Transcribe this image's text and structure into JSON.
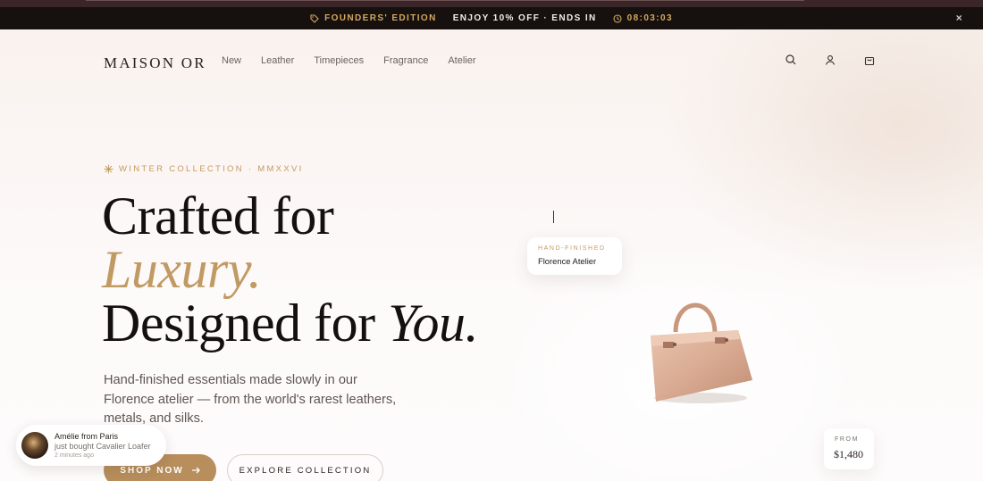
{
  "promo": {
    "edition": "FOUNDERS' EDITION",
    "offer": "ENJOY 10% OFF · ENDS IN",
    "timer": "08:03:03",
    "close": "×"
  },
  "nav": {
    "brand": "MAISON OR",
    "links": [
      "New",
      "Leather",
      "Timepieces",
      "Fragrance",
      "Atelier"
    ]
  },
  "hero": {
    "eyebrow": "WINTER COLLECTION · MMXXVI",
    "line1": "Crafted for",
    "line2": "Luxury.",
    "line3a": "Designed for ",
    "line3b": "You.",
    "sub": "Hand-finished essentials made slowly in our Florence atelier — from the world's rarest leathers, metals, and silks.",
    "shop_label": "SHOP NOW",
    "explore_label": "EXPLORE COLLECTION"
  },
  "badge_atelier": {
    "kicker": "HAND-FINISHED",
    "value": "Florence Atelier"
  },
  "badge_price": {
    "kicker": "FROM",
    "value": "$1,480"
  },
  "toast": {
    "line1": "Amélie from Paris",
    "line2": "just bought Cavalier Loafer",
    "line3": "2 minutes ago"
  },
  "colors": {
    "accent": "#b78e5c",
    "gold": "#c49a5e",
    "promo_bg": "#16100f"
  }
}
